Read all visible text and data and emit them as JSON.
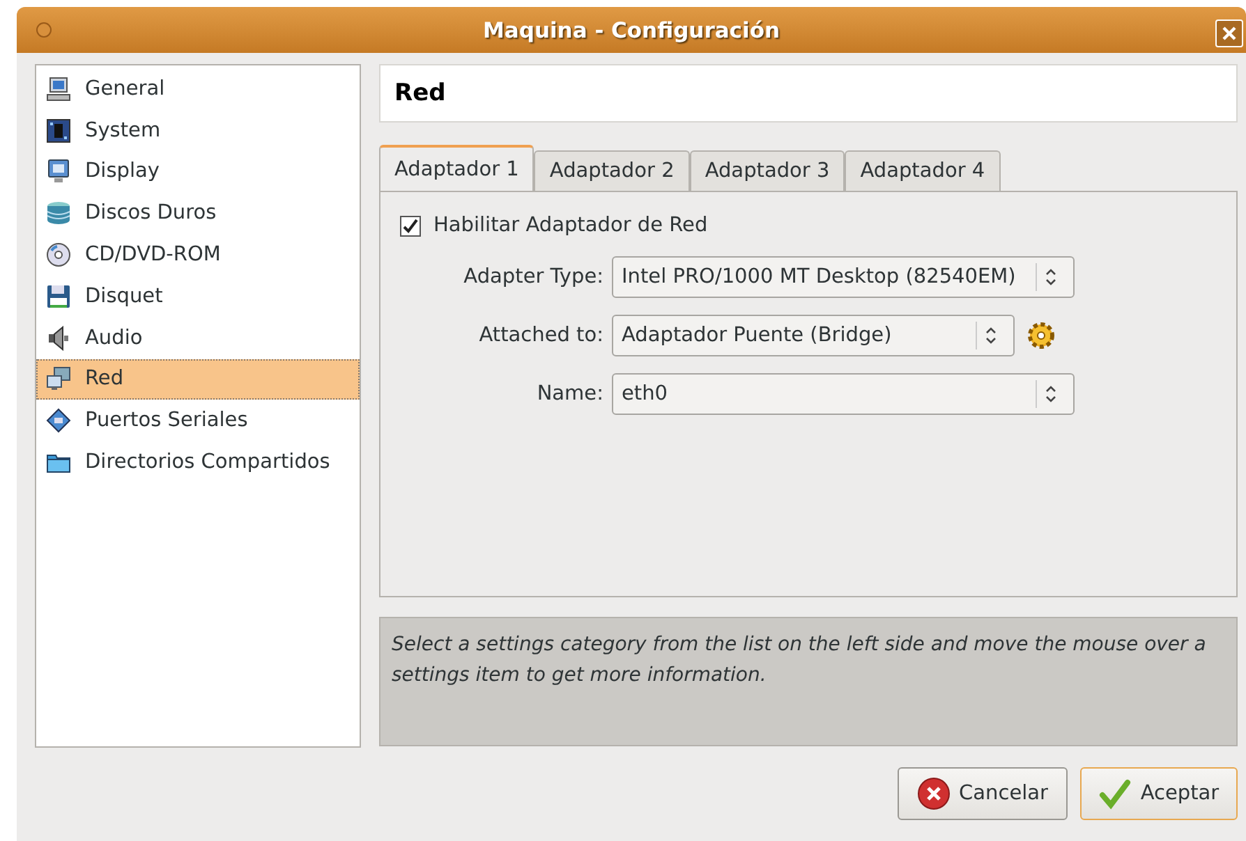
{
  "window": {
    "title": "Maquina - Configuración"
  },
  "sidebar": {
    "items": [
      {
        "label": "General",
        "selected": false
      },
      {
        "label": "System",
        "selected": false
      },
      {
        "label": "Display",
        "selected": false
      },
      {
        "label": "Discos Duros",
        "selected": false
      },
      {
        "label": "CD/DVD-ROM",
        "selected": false
      },
      {
        "label": "Disquet",
        "selected": false
      },
      {
        "label": "Audio",
        "selected": false
      },
      {
        "label": "Red",
        "selected": true
      },
      {
        "label": "Puertos Seriales",
        "selected": false
      },
      {
        "label": "Directorios Compartidos",
        "selected": false
      }
    ]
  },
  "page_title": "Red",
  "tabs": [
    {
      "label": "Adaptador 1",
      "selected": true
    },
    {
      "label": "Adaptador 2",
      "selected": false
    },
    {
      "label": "Adaptador 3",
      "selected": false
    },
    {
      "label": "Adaptador 4",
      "selected": false
    }
  ],
  "enable_checkbox": {
    "label": "Habilitar Adaptador de Red",
    "checked": true
  },
  "fields": [
    {
      "label": "Adapter Type:",
      "value": "Intel PRO/1000 MT Desktop (82540EM)",
      "settings_button": false
    },
    {
      "label": "Attached to:",
      "value": "Adaptador Puente (Bridge)",
      "settings_button": true
    },
    {
      "label": "Name:",
      "value": "eth0",
      "settings_button": false
    }
  ],
  "info_text": "Select a settings category from the list on the left side and move the mouse over a settings item to get more information.",
  "buttons": [
    {
      "label": "Cancelar",
      "kind": "cancel"
    },
    {
      "label": "Aceptar",
      "kind": "ok"
    }
  ]
}
